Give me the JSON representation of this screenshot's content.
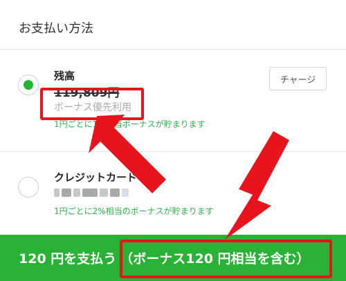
{
  "header": {
    "title": "お支払い方法"
  },
  "balance_option": {
    "title": "残高",
    "amount": "119,809円",
    "note": "ボーナス優先利用",
    "bonus_text": "1円ごとに1%相当ボーナスが貯まります",
    "charge_label": "チャージ",
    "selected": true
  },
  "credit_option": {
    "title": "クレジットカード",
    "bonus_text": "1円ごとに2%相当のボーナスが貯まります",
    "selected": false
  },
  "pay_button": {
    "prefix": "120 円を支払う",
    "suffix": "（ボーナス120 円相当を含む）"
  },
  "colors": {
    "accent": "#29b235",
    "annotation": "#e8141b"
  }
}
